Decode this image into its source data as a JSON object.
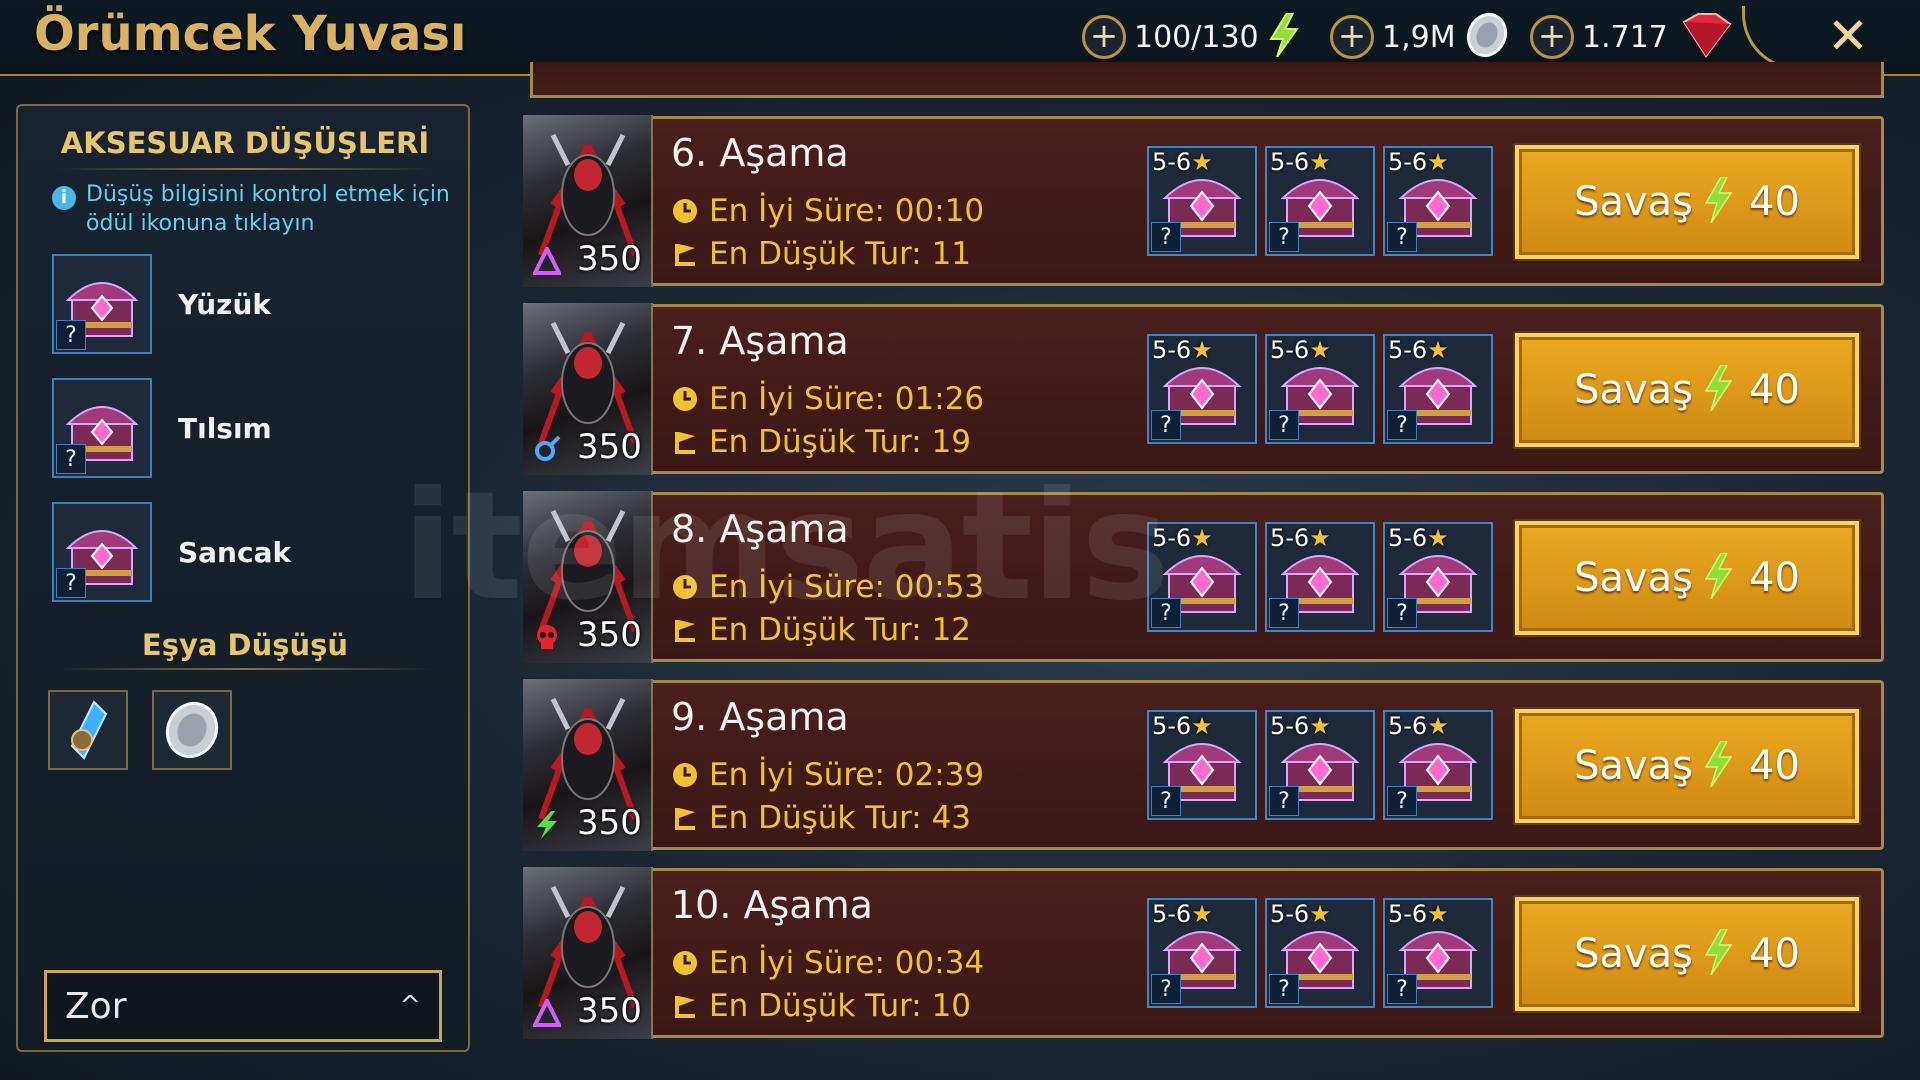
{
  "header": {
    "title": "Örümcek Yuvası",
    "energy": "100/130",
    "silver": "1,9M",
    "gems": "1.717",
    "plus": "+",
    "close": "✕"
  },
  "left_panel": {
    "title": "AKSESUAR DÜŞÜŞLERİ",
    "info": "Düşüş bilgisini kontrol etmek için ödül ikonuna tıklayın",
    "info_icon": "i",
    "accessories": [
      {
        "label": "Yüzük",
        "badge": "?"
      },
      {
        "label": "Tılsım",
        "badge": "?"
      },
      {
        "label": "Sancak",
        "badge": "?"
      }
    ],
    "item_drop_title": "Eşya Düşüşü",
    "difficulty": "Zor",
    "difficulty_caret": "^"
  },
  "stages": [
    {
      "name": "6. Aşama",
      "best_time": "En İyi Süre: 00:10",
      "min_turns": "En Düşük Tur: 11",
      "level": "350",
      "affinity": "magic"
    },
    {
      "name": "7. Aşama",
      "best_time": "En İyi Süre: 01:26",
      "min_turns": "En Düşük Tur: 19",
      "level": "350",
      "affinity": "void"
    },
    {
      "name": "8. Aşama",
      "best_time": "En İyi Süre: 00:53",
      "min_turns": "En Düşük Tur: 12",
      "level": "350",
      "affinity": "force"
    },
    {
      "name": "9. Aşama",
      "best_time": "En İyi Süre: 02:39",
      "min_turns": "En Düşük Tur: 43",
      "level": "350",
      "affinity": "spirit"
    },
    {
      "name": "10. Aşama",
      "best_time": "En İyi Süre: 00:34",
      "min_turns": "En Düşük Tur: 10",
      "level": "350",
      "affinity": "magic"
    }
  ],
  "reward_stars": "5-6",
  "reward_star_glyph": "★",
  "reward_badge": "?",
  "battle": {
    "label": "Savaş",
    "cost": "40"
  },
  "watermark": "itemsatis",
  "colors": {
    "gold": "#d9b160",
    "stage_bg": "#3f1a18",
    "button": "#e09a1a",
    "info_blue": "#5ed0f2",
    "stat_yellow": "#f0c232"
  }
}
